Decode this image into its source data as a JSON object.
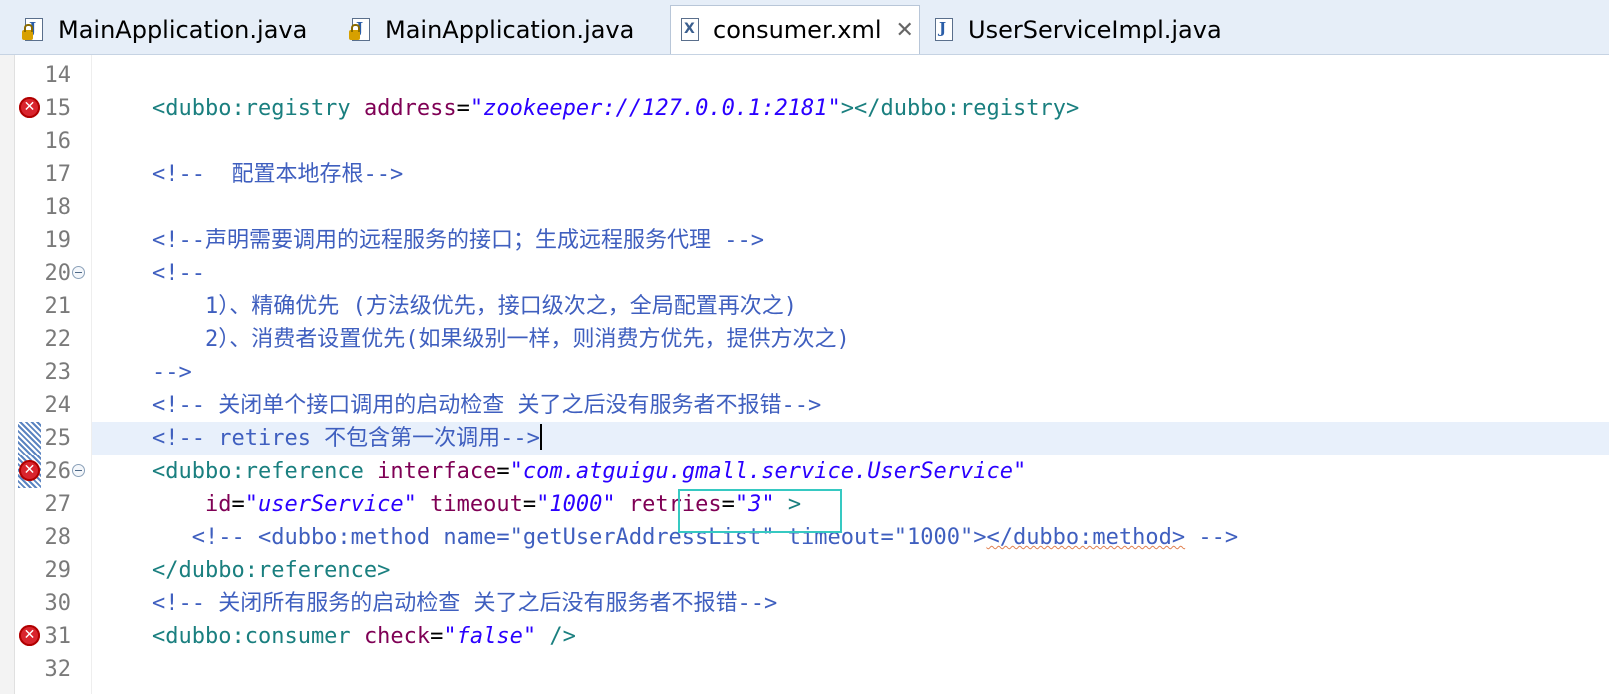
{
  "tabs": [
    {
      "label": "MainApplication.java",
      "icon": "java-file-locked-icon",
      "active": false
    },
    {
      "label": "MainApplication.java",
      "icon": "java-file-locked-icon",
      "active": false
    },
    {
      "label": "consumer.xml",
      "icon": "xml-file-icon",
      "active": true,
      "close": "✕"
    },
    {
      "label": "UserServiceImpl.java",
      "icon": "java-file-icon",
      "active": false
    }
  ],
  "lines": [
    {
      "num": "14"
    },
    {
      "num": "15",
      "marker": "error",
      "tag_open": "<dubbo:registry",
      "attr": "address",
      "eq": "=",
      "val": "\"zookeeper://127.0.0.1:2181\"",
      "tag_close": "></dubbo:registry>"
    },
    {
      "num": "16"
    },
    {
      "num": "17",
      "comment": "<!--  配置本地存根-->"
    },
    {
      "num": "18"
    },
    {
      "num": "19",
      "comment": "<!--声明需要调用的远程服务的接口；生成远程服务代理 -->"
    },
    {
      "num": "20",
      "fold": true,
      "comment": "<!--"
    },
    {
      "num": "21",
      "comment": "    1）、精确优先 (方法级优先，接口级次之，全局配置再次之)"
    },
    {
      "num": "22",
      "comment": "    2）、消费者设置优先(如果级别一样，则消费方优先，提供方次之)"
    },
    {
      "num": "23",
      "comment": "-->"
    },
    {
      "num": "24",
      "comment": "<!-- 关闭单个接口调用的启动检查 关了之后没有服务者不报错-->"
    },
    {
      "num": "25",
      "current": true,
      "comment": "<!-- retires 不包含第一次调用-->"
    },
    {
      "num": "26",
      "marker": "error",
      "fold": true,
      "tag_open": "<dubbo:reference",
      "attr": "interface",
      "eq": "=",
      "val": "\"com.atguigu.gmall.service.UserService\""
    },
    {
      "num": "27",
      "indent": "    ",
      "a1": "id",
      "v1": "\"userService\"",
      "a2": "timeout",
      "v2": "\"1000\"",
      "a3": "retries",
      "v3": "\"3\"",
      "end": " >"
    },
    {
      "num": "28",
      "comment_a": "   <!-- <dubbo:method name=\"getUserAddressList\" timeout=\"1000\">",
      "comment_b": "</dubbo:method>",
      "comment_c": " -->"
    },
    {
      "num": "29",
      "tag_close": "</dubbo:reference>"
    },
    {
      "num": "30",
      "comment": "<!-- 关闭所有服务的启动检查 关了之后没有服务者不报错-->"
    },
    {
      "num": "31",
      "marker": "error",
      "tag_open": "<dubbo:consumer",
      "attr": "check",
      "eq": "=",
      "val": "\"false\"",
      "tag_close": " />"
    },
    {
      "num": "32"
    }
  ],
  "colors": {
    "tag": "#1a7f7f",
    "attr": "#7f0055",
    "value": "#2a00ff",
    "comment": "#3f5fbf",
    "highlight_box": "#36c9c2",
    "current_line": "#e8f0fb"
  }
}
